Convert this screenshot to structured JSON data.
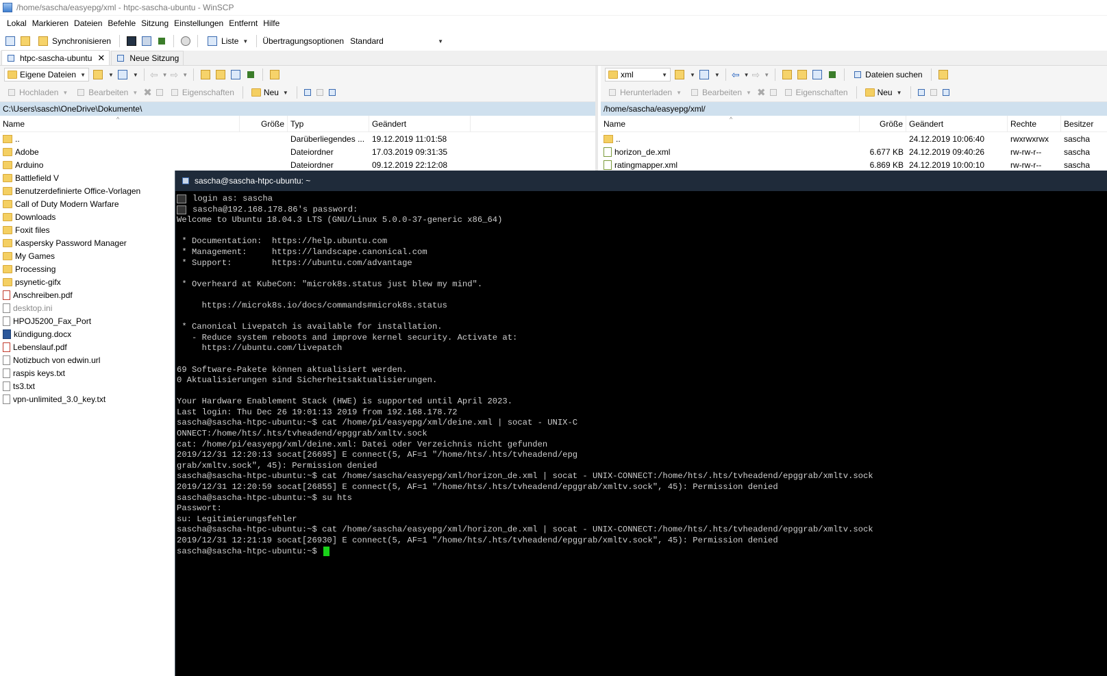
{
  "window": {
    "title": "/home/sascha/easyepg/xml - htpc-sascha-ubuntu - WinSCP"
  },
  "menu": [
    "Lokal",
    "Markieren",
    "Dateien",
    "Befehle",
    "Sitzung",
    "Einstellungen",
    "Entfernt",
    "Hilfe"
  ],
  "toolbar": {
    "synchronize": "Synchronisieren",
    "list": "Liste",
    "transfer_options": "Übertragungsoptionen",
    "transfer_preset": "Standard"
  },
  "tabs": {
    "session": "htpc-sascha-ubuntu",
    "new_session": "Neue Sitzung"
  },
  "left": {
    "location": "Eigene Dateien",
    "upload": "Hochladen",
    "edit": "Bearbeiten",
    "properties": "Eigenschaften",
    "new": "Neu",
    "path": "C:\\Users\\sasch\\OneDrive\\Dokumente\\",
    "columns": {
      "name": "Name",
      "size": "Größe",
      "type": "Typ",
      "changed": "Geändert"
    },
    "rows": [
      {
        "name": "..",
        "icon": "up",
        "type": "Darüberliegendes ...",
        "changed": "19.12.2019  11:01:58"
      },
      {
        "name": "Adobe",
        "icon": "folder",
        "type": "Dateiordner",
        "changed": "17.03.2019  09:31:35"
      },
      {
        "name": "Arduino",
        "icon": "folder",
        "type": "Dateiordner",
        "changed": "09.12.2019  22:12:08"
      },
      {
        "name": "Battlefield V",
        "icon": "folder"
      },
      {
        "name": "Benutzerdefinierte Office-Vorlagen",
        "icon": "folder"
      },
      {
        "name": "Call of Duty Modern Warfare",
        "icon": "folder"
      },
      {
        "name": "Downloads",
        "icon": "folder"
      },
      {
        "name": "Foxit files",
        "icon": "folder"
      },
      {
        "name": "Kaspersky Password Manager",
        "icon": "folder"
      },
      {
        "name": "My Games",
        "icon": "folder"
      },
      {
        "name": "Processing",
        "icon": "folder"
      },
      {
        "name": "psynetic-gifx",
        "icon": "folder"
      },
      {
        "name": "Anschreiben.pdf",
        "icon": "pdf"
      },
      {
        "name": "desktop.ini",
        "icon": "file",
        "dim": true
      },
      {
        "name": "HPOJ5200_Fax_Port",
        "icon": "file"
      },
      {
        "name": "kündigung.docx",
        "icon": "doc"
      },
      {
        "name": "Lebenslauf.pdf",
        "icon": "pdf"
      },
      {
        "name": "Notizbuch von edwin.url",
        "icon": "file"
      },
      {
        "name": "raspis keys.txt",
        "icon": "file"
      },
      {
        "name": "ts3.txt",
        "icon": "file"
      },
      {
        "name": "vpn-unlimited_3.0_key.txt",
        "icon": "file"
      }
    ]
  },
  "right": {
    "location": "xml",
    "find_files": "Dateien suchen",
    "download": "Herunterladen",
    "edit": "Bearbeiten",
    "properties": "Eigenschaften",
    "new": "Neu",
    "path": "/home/sascha/easyepg/xml/",
    "columns": {
      "name": "Name",
      "size": "Größe",
      "changed": "Geändert",
      "rights": "Rechte",
      "owner": "Besitzer"
    },
    "rows": [
      {
        "name": "..",
        "icon": "up",
        "size": "",
        "changed": "24.12.2019 10:06:40",
        "rights": "rwxrwxrwx",
        "owner": "sascha"
      },
      {
        "name": "horizon_de.xml",
        "icon": "xml",
        "size": "6.677 KB",
        "changed": "24.12.2019 09:40:26",
        "rights": "rw-rw-r--",
        "owner": "sascha"
      },
      {
        "name": "ratingmapper.xml",
        "icon": "xml",
        "size": "6.869 KB",
        "changed": "24.12.2019 10:00:10",
        "rights": "rw-rw-r--",
        "owner": "sascha"
      }
    ]
  },
  "terminal": {
    "title": "sascha@sascha-htpc-ubuntu: ~",
    "lines": [
      "login as: sascha",
      "sascha@192.168.178.86's password:",
      "Welcome to Ubuntu 18.04.3 LTS (GNU/Linux 5.0.0-37-generic x86_64)",
      "",
      " * Documentation:  https://help.ubuntu.com",
      " * Management:     https://landscape.canonical.com",
      " * Support:        https://ubuntu.com/advantage",
      "",
      " * Overheard at KubeCon: \"microk8s.status just blew my mind\".",
      "",
      "     https://microk8s.io/docs/commands#microk8s.status",
      "",
      " * Canonical Livepatch is available for installation.",
      "   - Reduce system reboots and improve kernel security. Activate at:",
      "     https://ubuntu.com/livepatch",
      "",
      "69 Software-Pakete können aktualisiert werden.",
      "0 Aktualisierungen sind Sicherheitsaktualisierungen.",
      "",
      "Your Hardware Enablement Stack (HWE) is supported until April 2023.",
      "Last login: Thu Dec 26 19:01:13 2019 from 192.168.178.72",
      "sascha@sascha-htpc-ubuntu:~$ cat /home/pi/easyepg/xml/deine.xml | socat - UNIX-C",
      "ONNECT:/home/hts/.hts/tvheadend/epggrab/xmltv.sock",
      "cat: /home/pi/easyepg/xml/deine.xml: Datei oder Verzeichnis nicht gefunden",
      "2019/12/31 12:20:13 socat[26695] E connect(5, AF=1 \"/home/hts/.hts/tvheadend/epg",
      "grab/xmltv.sock\", 45): Permission denied",
      "sascha@sascha-htpc-ubuntu:~$ cat /home/sascha/easyepg/xml/horizon_de.xml | socat - UNIX-CONNECT:/home/hts/.hts/tvheadend/epggrab/xmltv.sock",
      "2019/12/31 12:20:59 socat[26855] E connect(5, AF=1 \"/home/hts/.hts/tvheadend/epggrab/xmltv.sock\", 45): Permission denied",
      "sascha@sascha-htpc-ubuntu:~$ su hts",
      "Passwort:",
      "su: Legitimierungsfehler",
      "sascha@sascha-htpc-ubuntu:~$ cat /home/sascha/easyepg/xml/horizon_de.xml | socat - UNIX-CONNECT:/home/hts/.hts/tvheadend/epggrab/xmltv.sock",
      "2019/12/31 12:21:19 socat[26930] E connect(5, AF=1 \"/home/hts/.hts/tvheadend/epggrab/xmltv.sock\", 45): Permission denied"
    ],
    "prompt": "sascha@sascha-htpc-ubuntu:~$ "
  }
}
